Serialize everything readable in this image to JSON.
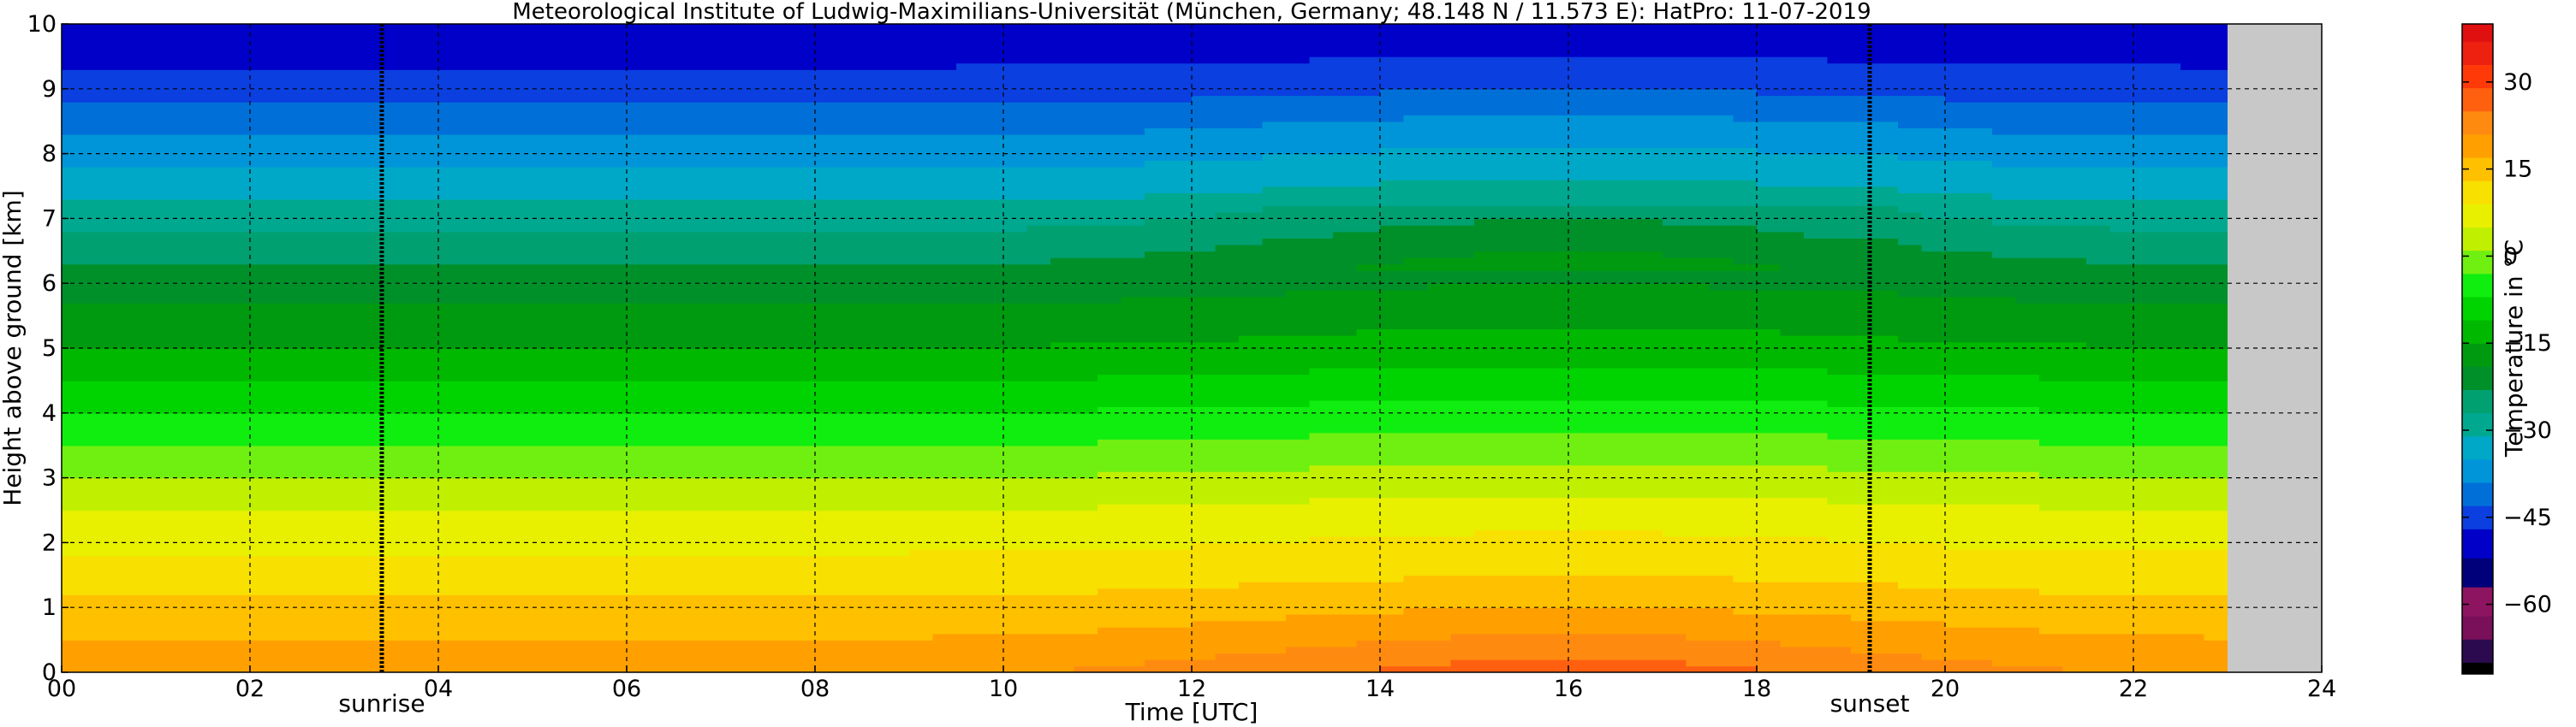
{
  "chart_data": {
    "type": "heatmap",
    "title": "Meteorological Institute of Ludwig-Maximilians-Universität (München, Germany; 48.148 N / 11.573 E):    HatPro: 11-07-2019",
    "xlabel": "Time [UTC]",
    "ylabel": "Height above ground [km]",
    "xlim": [
      0,
      24
    ],
    "ylim": [
      0,
      10
    ],
    "x_ticks": [
      0,
      2,
      4,
      6,
      8,
      10,
      12,
      14,
      16,
      18,
      20,
      22,
      24
    ],
    "x_tick_labels": [
      "00",
      "02",
      "04",
      "06",
      "08",
      "10",
      "12",
      "14",
      "16",
      "18",
      "20",
      "22",
      "24"
    ],
    "y_ticks": [
      0,
      1,
      2,
      3,
      4,
      5,
      6,
      7,
      8,
      9,
      10
    ],
    "y_tick_labels": [
      "0",
      "1",
      "2",
      "3",
      "4",
      "5",
      "6",
      "7",
      "8",
      "9",
      "10"
    ],
    "grid": true,
    "data_end_hour": 23.0,
    "colorbar": {
      "label": "Temperature in °C",
      "ticks": [
        30,
        15,
        0,
        -15,
        -30,
        -45,
        -60
      ],
      "tick_labels": [
        "30",
        "15",
        "0",
        "−15",
        "−30",
        "−45",
        "−60"
      ],
      "range": [
        -72,
        40
      ]
    },
    "annotations": [
      {
        "name": "sunrise",
        "label": "sunrise",
        "x": 3.4
      },
      {
        "name": "sunset",
        "label": "sunset",
        "x": 19.2
      }
    ],
    "temperature_profile": {
      "description_heights_km": [
        0,
        0.5,
        1,
        1.5,
        2,
        2.5,
        3,
        3.5,
        4,
        4.5,
        5,
        5.5,
        6,
        6.5,
        7,
        7.5,
        8,
        8.5,
        9,
        9.5,
        10
      ],
      "night_temps_c": [
        20,
        17,
        14,
        11,
        8,
        5,
        1,
        -3,
        -7,
        -11,
        -15,
        -18,
        -21,
        -25,
        -29,
        -33,
        -37,
        -41,
        -45,
        -48,
        -51
      ],
      "afternoon_temps_c": [
        27,
        22,
        17,
        13,
        10,
        7,
        3,
        -1,
        -5,
        -9,
        -13,
        -16,
        -19,
        -22,
        -26,
        -30,
        -34,
        -38,
        -43,
        -47,
        -50
      ]
    }
  }
}
